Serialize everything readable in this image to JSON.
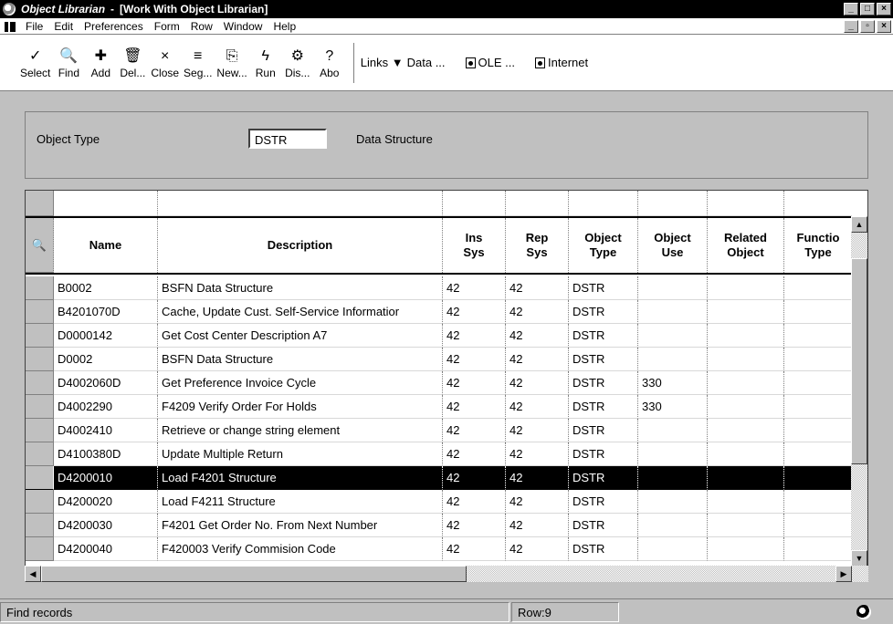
{
  "title": {
    "app": "Object Librarian",
    "sep": "-",
    "window": "[Work With Object Librarian]"
  },
  "menu": [
    "File",
    "Edit",
    "Preferences",
    "Form",
    "Row",
    "Window",
    "Help"
  ],
  "toolbar": {
    "buttons": [
      {
        "label": "Select",
        "icon": "✓"
      },
      {
        "label": "Find",
        "icon": "🔍"
      },
      {
        "label": "Add",
        "icon": "✚"
      },
      {
        "label": "Del...",
        "icon": "🗑"
      },
      {
        "label": "Close",
        "icon": "×"
      },
      {
        "label": "Seg...",
        "icon": "≡"
      },
      {
        "label": "New...",
        "icon": "⎘"
      },
      {
        "label": "Run",
        "icon": "ϟ"
      },
      {
        "label": "Dis...",
        "icon": "⚙"
      },
      {
        "label": "Abo",
        "icon": "?"
      }
    ],
    "links": "Links",
    "data": "Data ...",
    "ole": "OLE ...",
    "internet": "Internet"
  },
  "filter": {
    "label": "Object Type",
    "value": "DSTR",
    "desc": "Data Structure"
  },
  "columns": [
    {
      "l1": "Name",
      "l2": ""
    },
    {
      "l1": "Description",
      "l2": ""
    },
    {
      "l1": "Ins",
      "l2": "Sys"
    },
    {
      "l1": "Rep",
      "l2": "Sys"
    },
    {
      "l1": "Object",
      "l2": "Type"
    },
    {
      "l1": "Object",
      "l2": "Use"
    },
    {
      "l1": "Related",
      "l2": "Object"
    },
    {
      "l1": "Functio",
      "l2": "Type"
    }
  ],
  "rows": [
    {
      "name": "B0002",
      "desc": "BSFN Data Structure",
      "ins": "42",
      "rep": "42",
      "type": "DSTR",
      "use": "",
      "rel": "",
      "func": ""
    },
    {
      "name": "B4201070D",
      "desc": "Cache, Update Cust. Self-Service Informatior",
      "ins": "42",
      "rep": "42",
      "type": "DSTR",
      "use": "",
      "rel": "",
      "func": ""
    },
    {
      "name": "D0000142",
      "desc": "Get Cost Center Description A7",
      "ins": "42",
      "rep": "42",
      "type": "DSTR",
      "use": "",
      "rel": "",
      "func": ""
    },
    {
      "name": "D0002",
      "desc": "BSFN Data Structure",
      "ins": "42",
      "rep": "42",
      "type": "DSTR",
      "use": "",
      "rel": "",
      "func": ""
    },
    {
      "name": "D4002060D",
      "desc": "Get Preference Invoice Cycle",
      "ins": "42",
      "rep": "42",
      "type": "DSTR",
      "use": "330",
      "rel": "",
      "func": ""
    },
    {
      "name": "D4002290",
      "desc": "F4209 Verify Order For Holds",
      "ins": "42",
      "rep": "42",
      "type": "DSTR",
      "use": "330",
      "rel": "",
      "func": ""
    },
    {
      "name": "D4002410",
      "desc": "Retrieve or change string element",
      "ins": "42",
      "rep": "42",
      "type": "DSTR",
      "use": "",
      "rel": "",
      "func": ""
    },
    {
      "name": "D4100380D",
      "desc": "Update Multiple Return",
      "ins": "42",
      "rep": "42",
      "type": "DSTR",
      "use": "",
      "rel": "",
      "func": ""
    },
    {
      "name": "D4200010",
      "desc": "Load F4201 Structure",
      "ins": "42",
      "rep": "42",
      "type": "DSTR",
      "use": "",
      "rel": "",
      "func": ""
    },
    {
      "name": "D4200020",
      "desc": "Load F4211 Structure",
      "ins": "42",
      "rep": "42",
      "type": "DSTR",
      "use": "",
      "rel": "",
      "func": ""
    },
    {
      "name": "D4200030",
      "desc": "F4201 Get Order No. From Next Number",
      "ins": "42",
      "rep": "42",
      "type": "DSTR",
      "use": "",
      "rel": "",
      "func": ""
    },
    {
      "name": "D4200040",
      "desc": "F420003 Verify Commision Code",
      "ins": "42",
      "rep": "42",
      "type": "DSTR",
      "use": "",
      "rel": "",
      "func": ""
    }
  ],
  "selected_row_index": 8,
  "status": {
    "text": "Find records",
    "row": "Row:9"
  }
}
